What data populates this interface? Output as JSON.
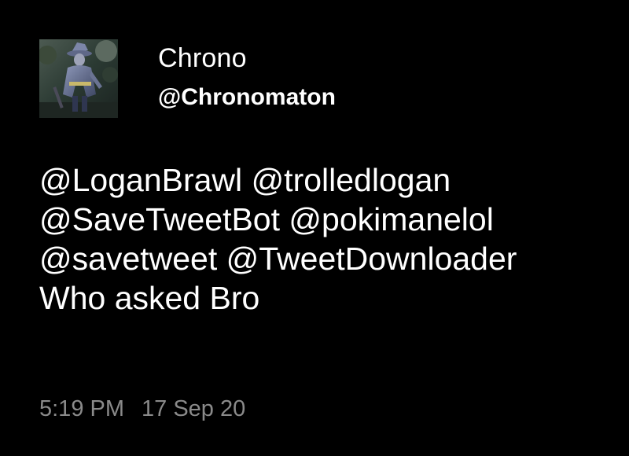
{
  "author": {
    "display_name": "Chrono",
    "handle": "@Chronomaton",
    "avatar_icon": "armored-knight-avatar"
  },
  "tweet": {
    "lines": [
      {
        "mentions": [
          "@LoganBrawl",
          "@trolledlogan"
        ]
      },
      {
        "mentions": [
          "@SaveTweetBot",
          "@pokimanelol"
        ]
      },
      {
        "mentions": [
          "@savetweet",
          "@TweetDownloader"
        ]
      }
    ],
    "text": "Who asked Bro"
  },
  "meta": {
    "time": "5:19 PM",
    "date": "17 Sep 20"
  },
  "colors": {
    "background": "#000000",
    "text": "#ffffff",
    "meta": "#8a8a8a"
  }
}
